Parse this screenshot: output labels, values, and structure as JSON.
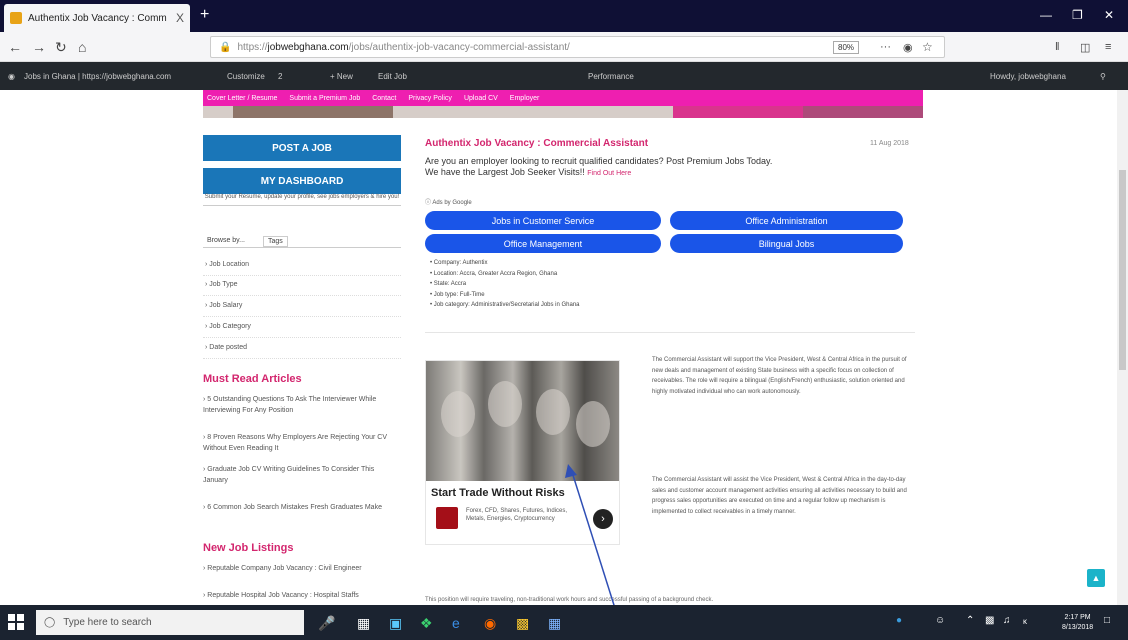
{
  "browser": {
    "tab_title": "Authentix Job Vacancy : Comm",
    "tab_close": "X",
    "new_tab": "+",
    "url_prefix": "https://",
    "url_domain": "jobwebghana.com",
    "url_path": "/jobs/authentix-job-vacancy-commercial-assistant/",
    "zoom": "80%",
    "menu_dots": "···"
  },
  "wpbar": {
    "site": "Jobs in Ghana | https://jobwebghana.com",
    "customize": "Customize",
    "comments": "2",
    "new": "+ New",
    "edit": "Edit Job",
    "perf": "Performance",
    "user": "Howdy, jobwebghana"
  },
  "topmenu": [
    "Cover Letter / Resume",
    "Submit a Premium Job",
    "Contact",
    "Privacy Policy",
    "Upload CV",
    "Employer"
  ],
  "sidebar": {
    "post_job": "POST A JOB",
    "dashboard": "MY DASHBOARD",
    "dashboard_note": "Submit your Resume, update your profile, see jobs employers & hire you!",
    "browse_tab": "Browse by...",
    "tags_tab": "Tags",
    "browse_items": [
      "Job Location",
      "Job Type",
      "Job Salary",
      "Job Category",
      "Date posted"
    ],
    "must_read": "Must Read Articles",
    "articles": [
      "5 Outstanding Questions To Ask The Interviewer While Interviewing For Any Position",
      "8 Proven Reasons Why Employers Are Rejecting Your CV Without Even Reading It",
      "Graduate Job CV Writing Guidelines To Consider This January",
      "6 Common Job Search Mistakes Fresh Graduates Make"
    ],
    "new_listings": "New Job Listings",
    "listings": [
      "Reputable Company Job Vacancy : Civil Engineer",
      "Reputable Hospital Job Vacancy : Hospital Staffs"
    ]
  },
  "main": {
    "title": "Authentix Job Vacancy : Commercial Assistant",
    "date": "11 Aug 2018",
    "promo_line1": "Are you an employer looking to recruit qualified candidates? Post Premium Jobs Today.",
    "promo_line2": "We have the Largest Job Seeker Visits!!",
    "promo_link": "Find Out Here",
    "ads_by": "Ads by Google",
    "pills": [
      "Jobs in Customer Service",
      "Office Administration",
      "Office Management",
      "Bilingual Jobs"
    ],
    "details": [
      "Company: Authentix",
      "Location: Accra, Greater Accra Region, Ghana",
      "State: Accra",
      "Job type: Full-Time",
      "Job category: Administrative/Secretarial Jobs in Ghana"
    ],
    "desc1": "The Commercial Assistant will support the Vice President, West & Central Africa in the pursuit of new deals and management of existing State business with a specific focus on collection of receivables. The role will require a bilingual (English/French) enthusiastic, solution oriented and highly motivated individual who can work autonomously.",
    "desc2": "The Commercial Assistant will assist the Vice President, West & Central Africa in the day-to-day sales and customer account management activities ensuring all activities necessary to build and progress sales opportunities are executed on time and a regular follow up mechanism is implemented to collect receivables in a timely manner.",
    "bottom": "This position will require traveling, non-traditional work hours and successful passing of a background check."
  },
  "ad": {
    "title": "Start Trade Without Risks",
    "text": "Forex, CFD, Shares, Futures, Indices, Metals, Energies, Cryptocurrency",
    "arrow": "›"
  },
  "taskbar": {
    "search_placeholder": "Type here to search",
    "time": "2:17 PM",
    "date": "8/13/2018"
  },
  "colors": {
    "accent_pink": "#d3266e",
    "menu_pink": "#ee1fb0",
    "side_blue": "#1a76b8",
    "pill_blue": "#1a55e8"
  }
}
